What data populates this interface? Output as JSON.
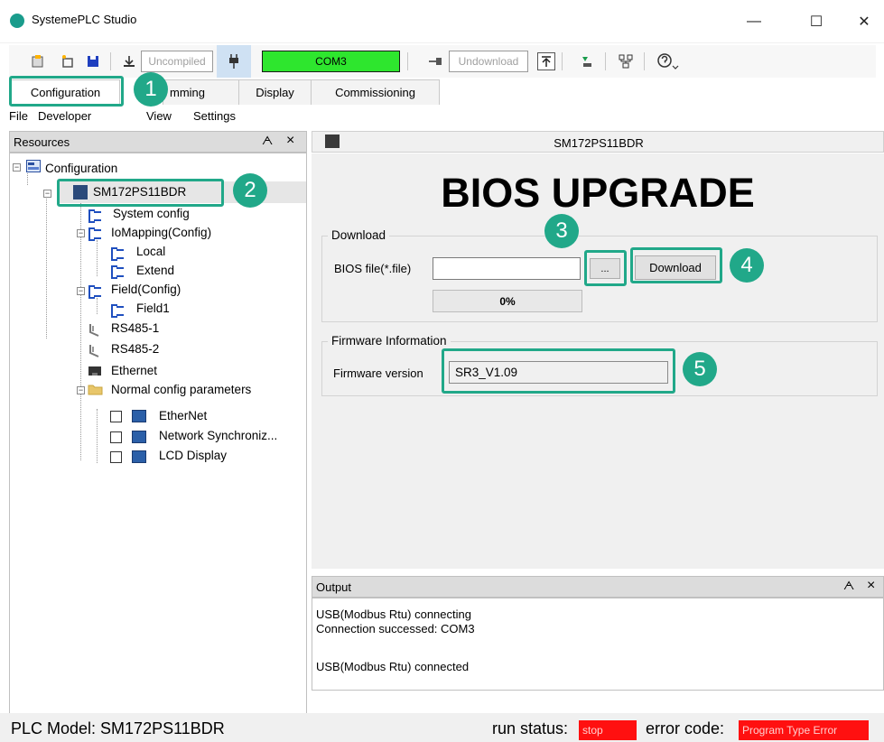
{
  "window": {
    "title": "SystemePLC Studio",
    "minimize_glyph": "—",
    "maximize_glyph": "☐",
    "close_glyph": "✕"
  },
  "toolbar": {
    "compile_status": "Uncompiled",
    "port": "COM3",
    "download_status": "Undownload",
    "port_color": "#2ee62e"
  },
  "tabs": [
    "Configuration",
    "Programming",
    "Display",
    "Commissioning"
  ],
  "tab_visible": [
    "Configuration",
    "mming",
    "Display",
    "Commissioning"
  ],
  "menu": [
    "File",
    "Developer",
    "View",
    "Settings"
  ],
  "resources": {
    "title": "Resources",
    "pin_glyph": "ᗅ",
    "close_glyph": "×",
    "tree": {
      "root": "Configuration",
      "device": "SM172PS11BDR",
      "system_config": "System config",
      "io_mapping": "IoMapping(Config)",
      "local": "Local",
      "extend": "Extend",
      "field": "Field(Config)",
      "field1": "Field1",
      "rs485_1": "RS485-1",
      "rs485_2": "RS485-2",
      "ethernet": "Ethernet",
      "normal_params": "Normal config parameters",
      "param_ethernet": "EtherNet",
      "param_netsync": "Network Synchroniz...",
      "param_lcd": "LCD Display"
    }
  },
  "device_header": "SM172PS11BDR",
  "bios": {
    "heading": "BIOS UPGRADE",
    "download_group": "Download",
    "file_label": "BIOS file(*.file)",
    "file_value": "",
    "browse_label": "...",
    "download_button": "Download",
    "progress": "0%",
    "progress_value": 0,
    "firmware_group": "Firmware Information",
    "firmware_label": "Firmware version",
    "firmware_value": "SR3_V1.09"
  },
  "output": {
    "title": "Output",
    "lines": [
      "USB(Modbus Rtu) connecting",
      "Connection successed: COM3",
      "",
      "USB(Modbus Rtu) connected"
    ]
  },
  "statusbar": {
    "plc_model": "PLC Model: SM172PS11BDR",
    "run_status_label": "run status:",
    "run_status_value": "stop",
    "error_code_label": "error code:",
    "error_code_value": "Program Type Error",
    "alert_color": "#ff1010"
  },
  "callouts": [
    "1",
    "2",
    "3",
    "4",
    "5"
  ],
  "callout_color": "#21a889"
}
